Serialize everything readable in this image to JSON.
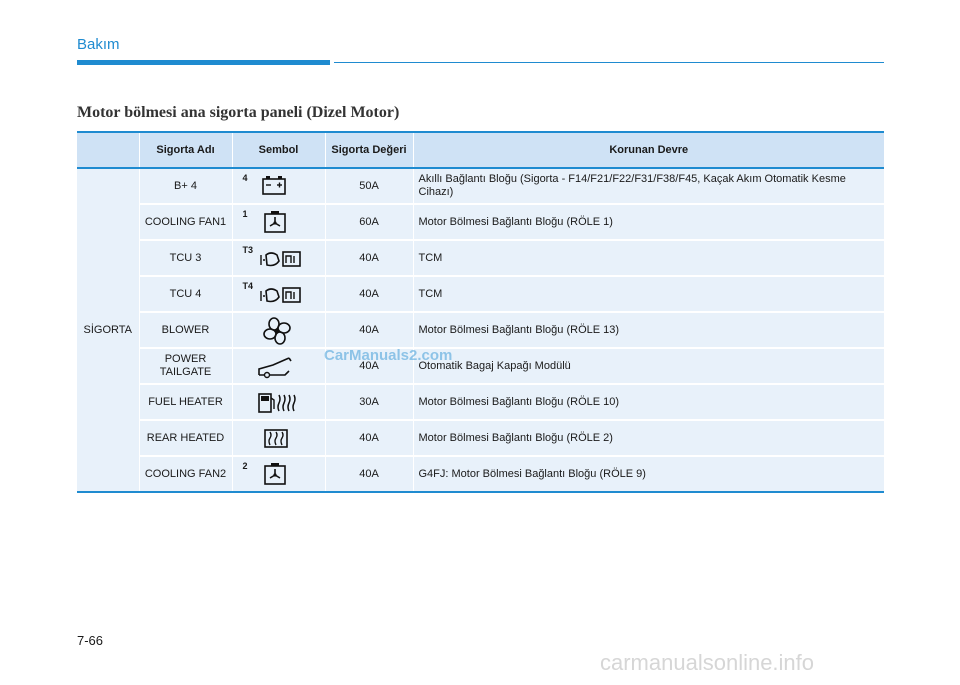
{
  "header": {
    "section": "Bakım"
  },
  "title": "Motor bölmesi ana sigorta paneli (Dizel Motor)",
  "table": {
    "columns": [
      "",
      "Sigorta Adı",
      "Sembol",
      "Sigorta Değeri",
      "Korunan Devre"
    ],
    "category": "SİGORTA",
    "rows": [
      {
        "name": "B+ 4",
        "symbol_icon": "battery-icon",
        "symbol_label": "4",
        "value": "50A",
        "circuit": "Akıllı Bağlantı Bloğu (Sigorta - F14/F21/F22/F31/F38/F45, Kaçak Akım Otomatik Kesme Cihazı)"
      },
      {
        "name": "COOLING FAN1",
        "symbol_icon": "cooling-fan-icon",
        "symbol_label": "1",
        "value": "60A",
        "circuit": "Motor Bölmesi Bağlantı Bloğu (RÖLE 1)"
      },
      {
        "name": "TCU 3",
        "symbol_icon": "transmission-control-icon",
        "symbol_label": "T3",
        "value": "40A",
        "circuit": "TCM"
      },
      {
        "name": "TCU 4",
        "symbol_icon": "transmission-control-icon",
        "symbol_label": "T4",
        "value": "40A",
        "circuit": "TCM"
      },
      {
        "name": "BLOWER",
        "symbol_icon": "blower-fan-icon",
        "symbol_label": "",
        "value": "40A",
        "circuit": "Motor Bölmesi Bağlantı Bloğu (RÖLE 13)"
      },
      {
        "name": "POWER TAILGATE",
        "symbol_icon": "power-tailgate-icon",
        "symbol_label": "",
        "value": "40A",
        "circuit": "Otomatik Bagaj Kapağı Modülü"
      },
      {
        "name": "FUEL HEATER",
        "symbol_icon": "fuel-heater-icon",
        "symbol_label": "",
        "value": "30A",
        "circuit": "Motor Bölmesi Bağlantı Bloğu (RÖLE 10)"
      },
      {
        "name": "REAR HEATED",
        "symbol_icon": "rear-defroster-icon",
        "symbol_label": "",
        "value": "40A",
        "circuit": "Motor Bölmesi Bağlantı Bloğu (RÖLE 2)"
      },
      {
        "name": "COOLING FAN2",
        "symbol_icon": "cooling-fan-icon",
        "symbol_label": "2",
        "value": "40A",
        "circuit": "G4FJ: Motor Bölmesi Bağlantı Bloğu (RÖLE 9)"
      }
    ]
  },
  "watermark": "CarManuals2.com",
  "page_number": "7-66",
  "footer_watermark": "carmanualsonline.info",
  "colors": {
    "accent": "#1f8bd0",
    "header_fill": "#cfe2f5",
    "row_fill": "#e8f1fa"
  }
}
